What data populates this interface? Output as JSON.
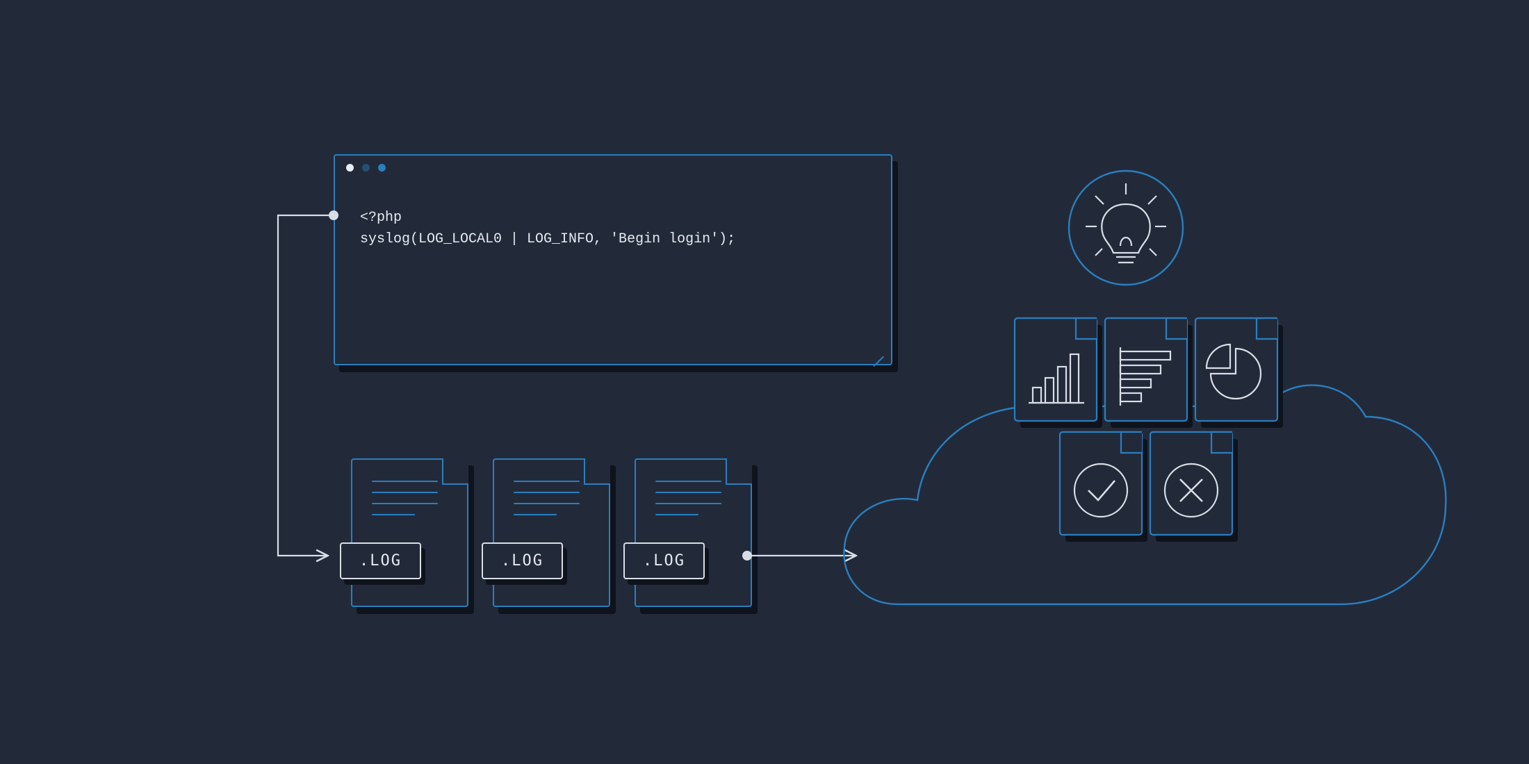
{
  "code_window": {
    "line1": "<?php",
    "line2": "syslog(LOG_LOCAL0 | LOG_INFO, 'Begin login');"
  },
  "log_files": [
    {
      "badge": ".LOG"
    },
    {
      "badge": ".LOG"
    },
    {
      "badge": ".LOG"
    }
  ],
  "colors": {
    "background": "#222a3a",
    "accent_blue": "#2a7fbf",
    "line_white": "#d9dee6",
    "shadow": "#0e131c"
  },
  "cloud_insight_cards": {
    "top_icon": "lightbulb",
    "row1": [
      "bar-chart",
      "horizontal-bars",
      "pie-chart"
    ],
    "row2": [
      "checkmark-circle",
      "x-circle"
    ]
  }
}
